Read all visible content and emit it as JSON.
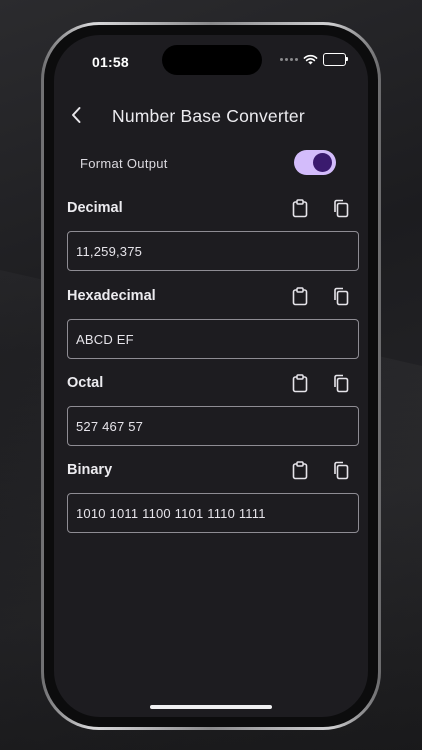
{
  "status_bar": {
    "time": "01:58"
  },
  "nav": {
    "title": "Number Base Converter"
  },
  "format_output": {
    "label": "Format Output",
    "enabled": true,
    "accent": "#d3bcfb",
    "knob": "#3a1a6e"
  },
  "fields": [
    {
      "label": "Decimal",
      "value": "11,259,375"
    },
    {
      "label": "Hexadecimal",
      "value": "ABCD EF"
    },
    {
      "label": "Octal",
      "value": "527 467 57"
    },
    {
      "label": "Binary",
      "value": "1010 1011 1100 1101 1110 1111"
    }
  ],
  "icons": {
    "back": "chevron-left-icon",
    "paste": "clipboard-icon",
    "copy": "copy-icon"
  },
  "colors": {
    "screen_bg": "#1d1c20",
    "border": "#8e8c93"
  }
}
